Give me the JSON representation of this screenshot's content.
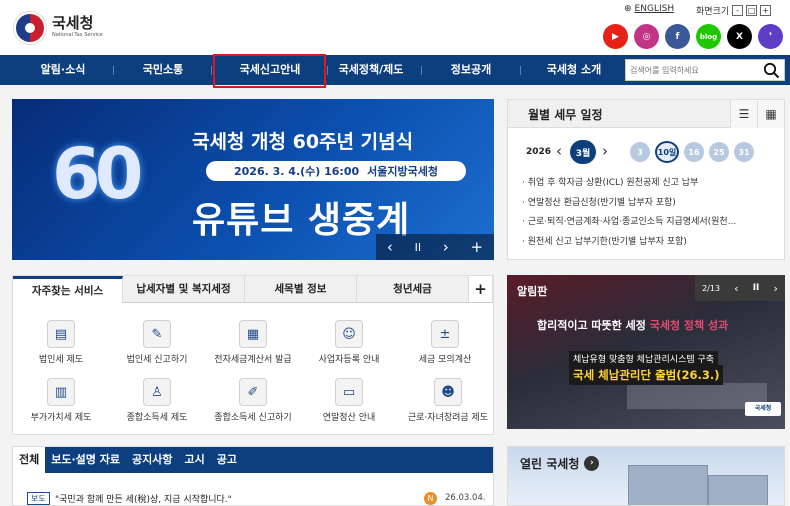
{
  "header": {
    "logo_ko": "국세청",
    "logo_en": "National Tax Service",
    "lang_label": "ENGLISH",
    "zoom_label": "화면크기",
    "zoom_minus": "-",
    "zoom_reset": "□",
    "zoom_plus": "+"
  },
  "sns": [
    {
      "name": "youtube",
      "label": "▶",
      "color": "#e62117"
    },
    {
      "name": "instagram",
      "label": "◎",
      "color": "#c13584"
    },
    {
      "name": "facebook",
      "label": "f",
      "color": "#3b5998"
    },
    {
      "name": "blog",
      "label": "blog",
      "color": "#1ec800"
    },
    {
      "name": "x",
      "label": "X",
      "color": "#000000"
    },
    {
      "name": "talk",
      "label": "❜",
      "color": "#5f3dc4"
    }
  ],
  "nav": {
    "items": [
      "알림·소식",
      "국민소통",
      "국세신고안내",
      "국세정책/제도",
      "정보공개",
      "국세청 소개"
    ],
    "search_placeholder": "검색어를 입력하세요"
  },
  "banner": {
    "big_num": "60",
    "title": "국세청 개청 60주년 기념식",
    "date": "2026. 3. 4.(수) 16:00",
    "place": "서울지방국세청",
    "headline": "유튜브 생중계",
    "prev": "‹",
    "pause": "II",
    "next": "›",
    "more": "+"
  },
  "calendar": {
    "title": "월별 세무 일정",
    "year": "2026",
    "month": "3월",
    "days": [
      "3",
      "10일",
      "16",
      "25",
      "31"
    ],
    "items": [
      "· 취업 후 학자금 상환(ICL) 원천공제 신고 납부",
      "· 연말정산 환급신청(반기별 납부자 포함)",
      "· 근로·퇴직·연금계좌·사업·종교인소득 지급명세서(원천...",
      "· 원천세 신고 납부기한(반기별 납부자 포함)"
    ]
  },
  "services": {
    "tabs": [
      "자주찾는 서비스",
      "납세자별 및 복지세정",
      "세목별 정보",
      "청년세금",
      "+"
    ],
    "items": [
      "법인세 제도",
      "법인세 신고하기",
      "전자세금계산서 발급",
      "사업자등록 안내",
      "세금 모의계산",
      "부가가치세 제도",
      "종합소득세 제도",
      "종합소득세 신고하기",
      "연말정산 안내",
      "근로·자녀장려금 제도"
    ]
  },
  "alrim": {
    "label": "알림판",
    "counter": "2/13",
    "title_a": "합리적이고 따뜻한 세정",
    "title_b": "국세청 정책 성과",
    "sub": "체납유형 맞춤형 체납관리시스템 구축",
    "main": "국세 체납관리단 출범(26.3.)",
    "footer": "국세청"
  },
  "news": {
    "tabs": [
      "전체",
      "보도·설명 자료",
      "공지사항",
      "고시",
      "공고"
    ],
    "badge": "보도",
    "text": "\"국민과 함께 만든 세(稅)상, 지금 시작합니다.\"",
    "new": "N",
    "date": "26.03.04."
  },
  "open": {
    "label": "열린 국세청",
    "arrow": "›"
  }
}
